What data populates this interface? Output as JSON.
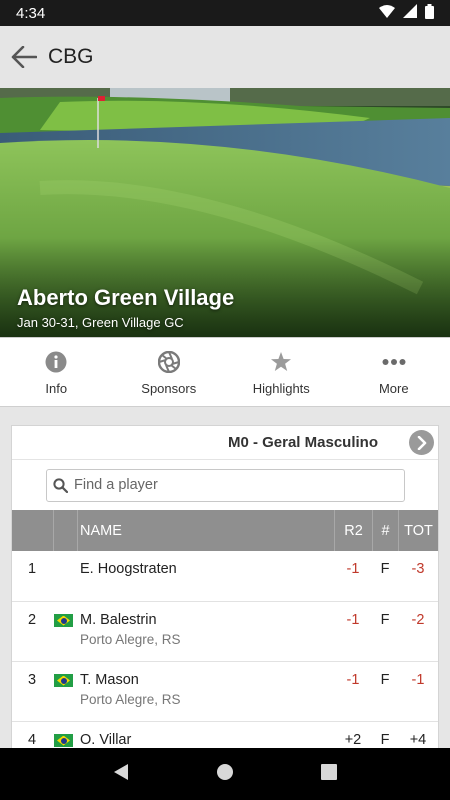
{
  "status": {
    "time": "4:34"
  },
  "appbar": {
    "title": "CBG"
  },
  "event": {
    "name": "Aberto Green Village",
    "details": "Jan 30-31, Green Village GC"
  },
  "tabs": [
    {
      "label": "Info",
      "icon": "info-icon"
    },
    {
      "label": "Sponsors",
      "icon": "aperture-icon"
    },
    {
      "label": "Highlights",
      "icon": "star-icon"
    },
    {
      "label": "More",
      "icon": "more-dots-icon"
    }
  ],
  "leaderboard": {
    "division": "M0 - Geral Masculino",
    "search_placeholder": "Find a player",
    "headers": {
      "name": "NAME",
      "r2": "R2",
      "thru": "#",
      "total": "TOT"
    },
    "rows": [
      {
        "pos": "1",
        "name": "E. Hoogstraten",
        "location": "",
        "flag": "",
        "r2": "-1",
        "thru": "F",
        "total": "-3"
      },
      {
        "pos": "2",
        "name": "M. Balestrin",
        "location": "Porto Alegre, RS",
        "flag": "brazil-flag",
        "r2": "-1",
        "thru": "F",
        "total": "-2"
      },
      {
        "pos": "3",
        "name": "T. Mason",
        "location": "Porto Alegre, RS",
        "flag": "brazil-flag",
        "r2": "-1",
        "thru": "F",
        "total": "-1"
      },
      {
        "pos": "4",
        "name": "O. Villar",
        "location": "",
        "flag": "brazil-flag",
        "r2": "+2",
        "thru": "F",
        "total": "+4"
      }
    ]
  },
  "colors": {
    "negative": "#c0392b",
    "header_bg": "#8f8f8f",
    "appbar_bg": "#e5e5e5"
  }
}
